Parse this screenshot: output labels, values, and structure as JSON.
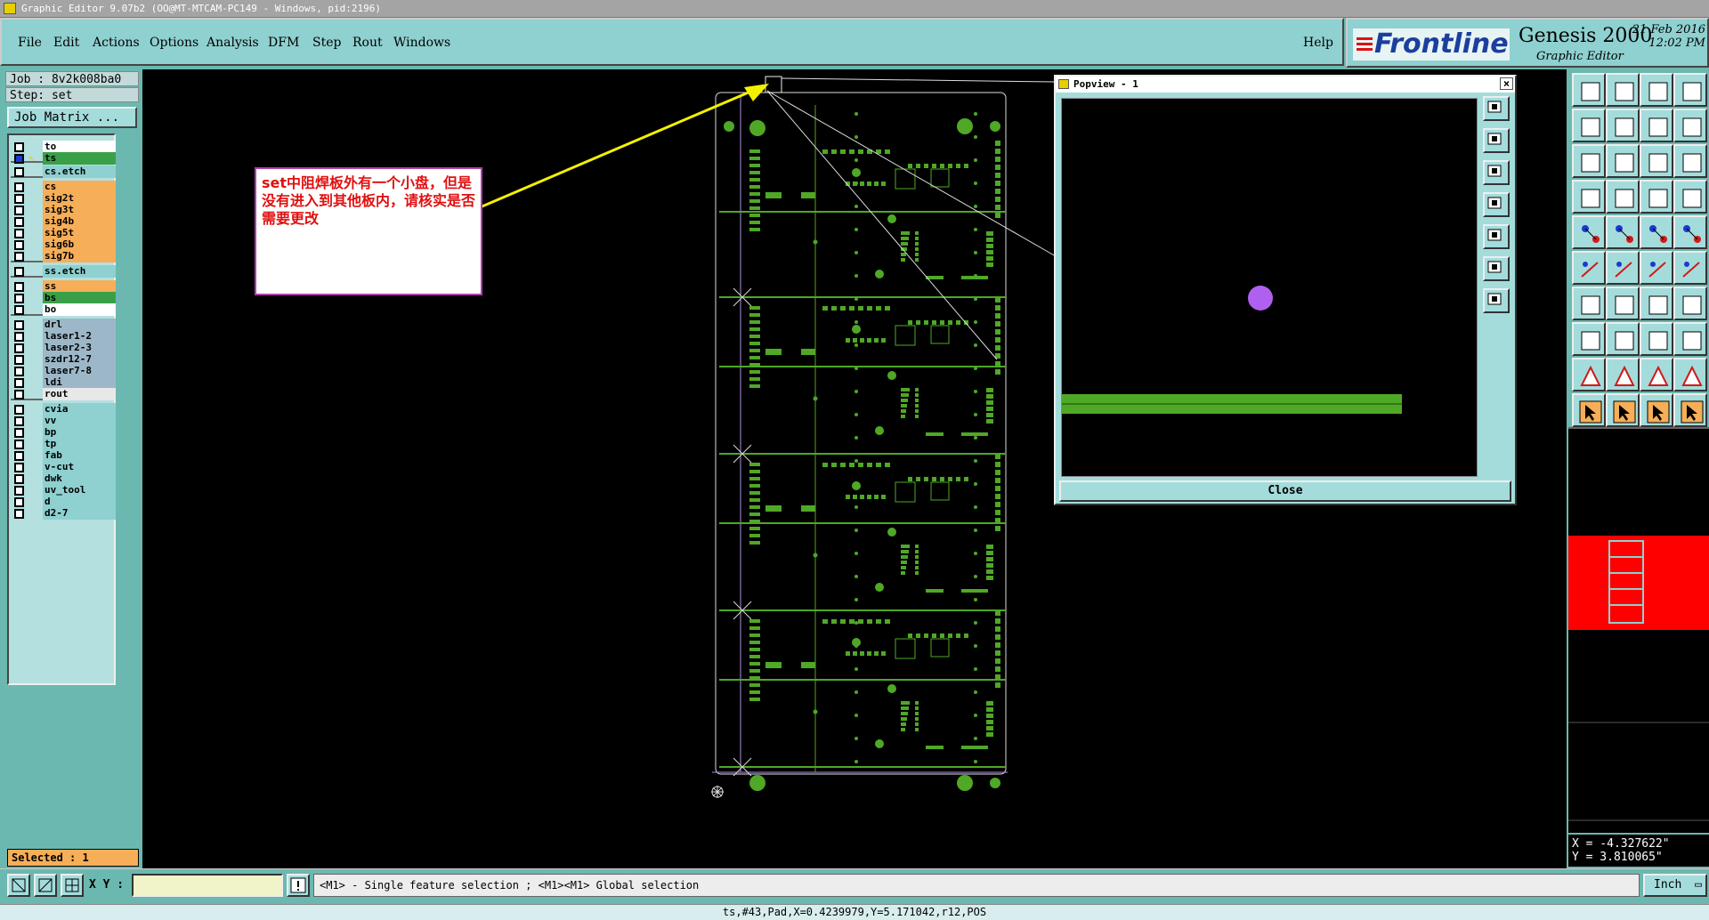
{
  "window": {
    "title": "Graphic Editor 9.07b2 (OO@MT-MTCAM-PC149 - Windows, pid:2196)"
  },
  "menu": {
    "file": "File",
    "edit": "Edit",
    "actions": "Actions",
    "options": "Options",
    "analysis": "Analysis",
    "dfm": "DFM",
    "step": "Step",
    "rout": "Rout",
    "windows": "Windows",
    "help": "Help"
  },
  "brand": {
    "logo": "Frontline",
    "product": "Genesis 2000",
    "subtitle": "Graphic Editor",
    "date": "21 Feb 2016",
    "time": "12:02 PM"
  },
  "job": {
    "job_label": "Job : 8v2k008ba0",
    "step_label": "Step: set",
    "matrix_button": "Job Matrix ..."
  },
  "layers": [
    {
      "name": "to",
      "color": "#ffffff"
    },
    {
      "name": "ts",
      "color": "#3aa048"
    },
    {
      "name": "cs.etch",
      "color": "#8fd0d0"
    },
    {
      "name": "cs",
      "color": "#f6ae58"
    },
    {
      "name": "sig2t",
      "color": "#f6ae58"
    },
    {
      "name": "sig3t",
      "color": "#f6ae58"
    },
    {
      "name": "sig4b",
      "color": "#f6ae58"
    },
    {
      "name": "sig5t",
      "color": "#f6ae58"
    },
    {
      "name": "sig6b",
      "color": "#f6ae58"
    },
    {
      "name": "sig7b",
      "color": "#f6ae58"
    },
    {
      "name": "ss.etch",
      "color": "#8fd0d0"
    },
    {
      "name": "ss",
      "color": "#f6ae58"
    },
    {
      "name": "bs",
      "color": "#3aa048"
    },
    {
      "name": "bo",
      "color": "#ffffff"
    },
    {
      "name": "drl",
      "color": "#9cb8c8"
    },
    {
      "name": "laser1-2",
      "color": "#9cb8c8"
    },
    {
      "name": "laser2-3",
      "color": "#9cb8c8"
    },
    {
      "name": "szdr12-7",
      "color": "#9cb8c8"
    },
    {
      "name": "laser7-8",
      "color": "#9cb8c8"
    },
    {
      "name": "ldi",
      "color": "#9cb8c8"
    },
    {
      "name": "rout",
      "color": "#e8e8e8"
    },
    {
      "name": "cvia",
      "color": "#8fd0d0"
    },
    {
      "name": "vv",
      "color": "#8fd0d0"
    },
    {
      "name": "bp",
      "color": "#8fd0d0"
    },
    {
      "name": "tp",
      "color": "#8fd0d0"
    },
    {
      "name": "fab",
      "color": "#8fd0d0"
    },
    {
      "name": "v-cut",
      "color": "#8fd0d0"
    },
    {
      "name": "dwk",
      "color": "#8fd0d0"
    },
    {
      "name": "uv_tool",
      "color": "#8fd0d0"
    },
    {
      "name": "d",
      "color": "#8fd0d0"
    },
    {
      "name": "d2-7",
      "color": "#8fd0d0"
    }
  ],
  "selected": "Selected : 1",
  "annotation": "set中阻焊板外有一个小盘，但是没有进入到其他板内，请核实是否需要更改",
  "popview": {
    "title": "Popview - 1",
    "close": "Close"
  },
  "coords": {
    "x": "X = -4.327622\"",
    "y": "Y = 3.810065\""
  },
  "status": {
    "xy_label": "X Y :",
    "hint": "<M1> - Single feature selection ; <M1><M1> Global selection",
    "unit": "Inch",
    "feature_info": "ts,#43,Pad,X=0.4239979,Y=5.171042,r12,POS"
  },
  "colors": {
    "pcb_green": "#4fa826",
    "panel_teal": "#6bb8b0",
    "pad_violet": "#b060f0"
  }
}
